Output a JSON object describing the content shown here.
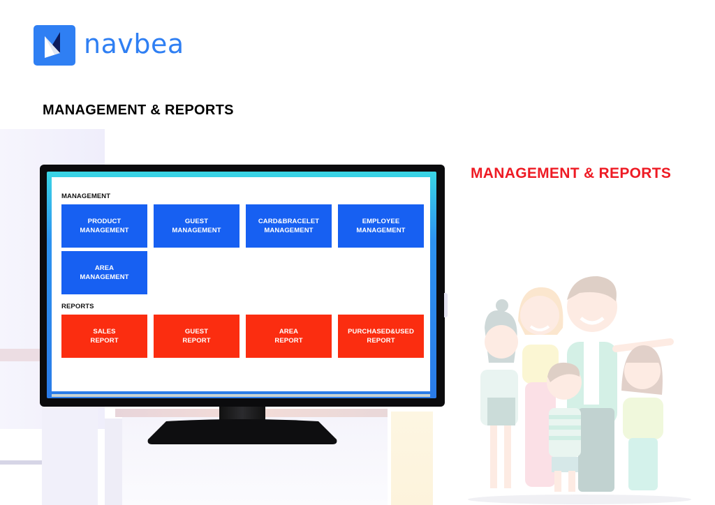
{
  "brand": {
    "name": "navbea",
    "logo_icon": "paper-plane-sail-icon",
    "color": "#2f7ff3"
  },
  "page_title": "MANAGEMENT & REPORTS",
  "side_title": "MANAGEMENT & REPORTS",
  "colors": {
    "management_tile": "#1760f2",
    "report_tile": "#fb2d10",
    "side_title": "#ee1b24"
  },
  "screen": {
    "management": {
      "label": "MANAGEMENT",
      "tiles": [
        {
          "line1": "PRODUCT",
          "line2": "MANAGEMENT"
        },
        {
          "line1": "GUEST",
          "line2": "MANAGEMENT"
        },
        {
          "line1": "CARD&BRACELET",
          "line2": "MANAGEMENT"
        },
        {
          "line1": "EMPLOYEE",
          "line2": "MANAGEMENT"
        },
        {
          "line1": "AREA",
          "line2": "MANAGEMENT"
        }
      ]
    },
    "reports": {
      "label": "REPORTS",
      "tiles": [
        {
          "line1": "SALES",
          "line2": "REPORT"
        },
        {
          "line1": "GUEST",
          "line2": "REPORT"
        },
        {
          "line1": "AREA",
          "line2": "REPORT"
        },
        {
          "line1": "PURCHASED&USED",
          "line2": "REPORT"
        }
      ]
    }
  },
  "illustration": "family-group-illustration"
}
